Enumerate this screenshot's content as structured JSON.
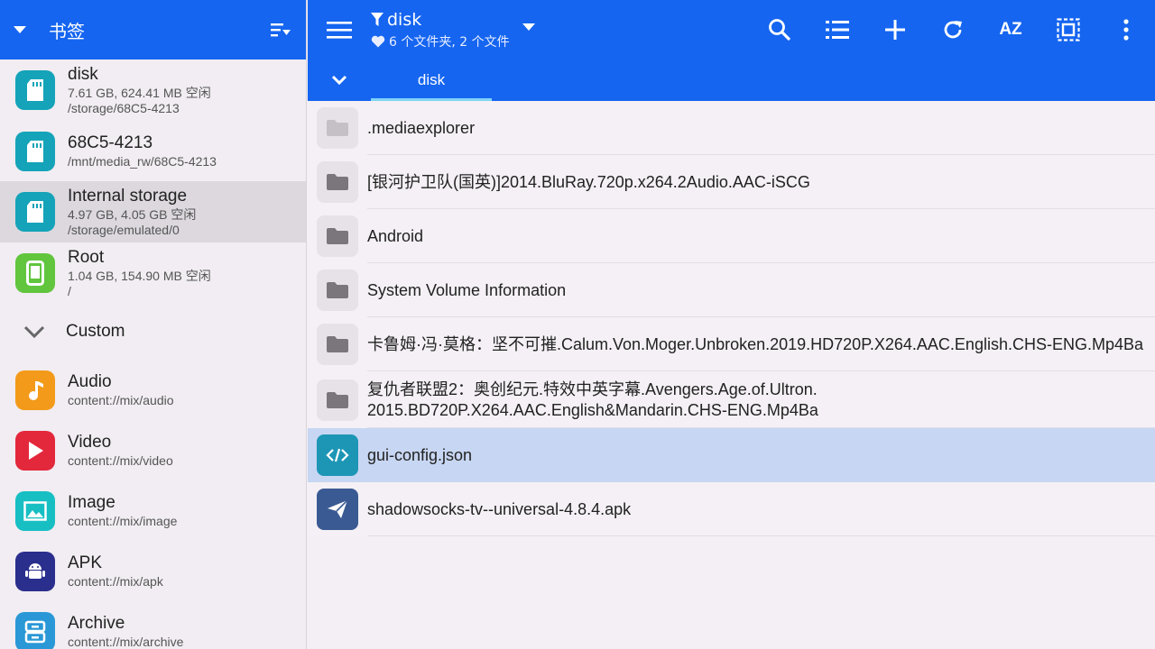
{
  "sidebar": {
    "title": "书签",
    "storage": [
      {
        "name": "disk",
        "size": "7.61 GB, 624.41 MB 空闲",
        "path": "/storage/68C5-4213"
      },
      {
        "name": "68C5-4213",
        "path": "/mnt/media_rw/68C5-4213"
      },
      {
        "name": "Internal storage",
        "size": "4.97 GB, 4.05 GB 空闲",
        "path": "/storage/emulated/0"
      },
      {
        "name": "Root",
        "size": "1.04 GB, 154.90 MB 空闲",
        "path": "/"
      }
    ],
    "custom_label": "Custom",
    "media": [
      {
        "name": "Audio",
        "path": "content://mix/audio"
      },
      {
        "name": "Video",
        "path": "content://mix/video"
      },
      {
        "name": "Image",
        "path": "content://mix/image"
      },
      {
        "name": "APK",
        "path": "content://mix/apk"
      },
      {
        "name": "Archive",
        "path": "content://mix/archive"
      }
    ]
  },
  "header": {
    "title": "disk",
    "subtitle": "6 个文件夹, 2 个文件",
    "tools": {
      "sort_label": "AZ"
    }
  },
  "tabs": [
    {
      "label": "disk"
    }
  ],
  "files": [
    {
      "name": ".mediaexplorer"
    },
    {
      "name": "[银河护卫队(国英)]2014.BluRay.720p.x264.2Audio.AAC-iSCG"
    },
    {
      "name": "Android"
    },
    {
      "name": "System Volume Information"
    },
    {
      "name": "卡鲁姆·冯·莫格：坚不可摧.Calum.Von.Moger.Unbroken.2019.HD720P.X264.AAC.English.CHS-ENG.Mp4Ba"
    },
    {
      "name": "复仇者联盟2：奥创纪元.特效中英字幕.Avengers.Age.of.Ultron.",
      "name2": "2015.BD720P.X264.AAC.English&Mandarin.CHS-ENG.Mp4Ba"
    },
    {
      "name": "gui-config.json"
    },
    {
      "name": "shadowsocks-tv--universal-4.8.4.apk"
    }
  ],
  "colors": {
    "accent": "#1565f0",
    "tab_indicator": "#7fd4f4",
    "selected_row": "#c7d6f2"
  }
}
